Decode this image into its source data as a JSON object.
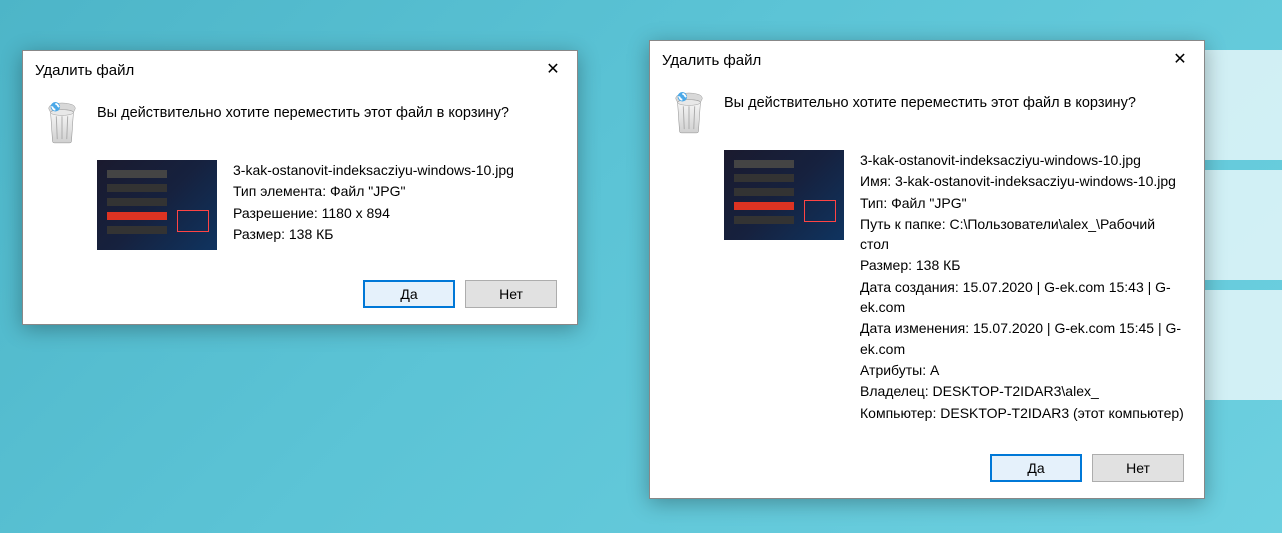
{
  "dialog1": {
    "title": "Удалить файл",
    "prompt": "Вы действительно хотите переместить этот файл в корзину?",
    "filename": "3-kak-ostanovit-indeksacziyu-windows-10.jpg",
    "type_label": "Тип элемента: Файл \"JPG\"",
    "resolution_label": "Разрешение: 1180 x 894",
    "size_label": "Размер: 138 КБ",
    "yes": "Да",
    "no": "Нет"
  },
  "dialog2": {
    "title": "Удалить файл",
    "prompt": "Вы действительно хотите переместить этот файл в корзину?",
    "filename": "3-kak-ostanovit-indeksacziyu-windows-10.jpg",
    "name_label": "Имя: 3-kak-ostanovit-indeksacziyu-windows-10.jpg",
    "type_label": "Тип: Файл \"JPG\"",
    "path_label": "Путь к папке: C:\\Пользователи\\alex_\\Рабочий стол",
    "size_label": "Размер: 138 КБ",
    "created_label": "Дата создания: 15.07.2020 | G-ek.com 15:43 | G-ek.com",
    "modified_label": "Дата изменения: 15.07.2020 | G-ek.com 15:45 | G-ek.com",
    "attributes_label": "Атрибуты: A",
    "owner_label": "Владелец: DESKTOP-T2IDAR3\\alex_",
    "computer_label": "Компьютер: DESKTOP-T2IDAR3 (этот компьютер)",
    "yes": "Да",
    "no": "Нет"
  }
}
